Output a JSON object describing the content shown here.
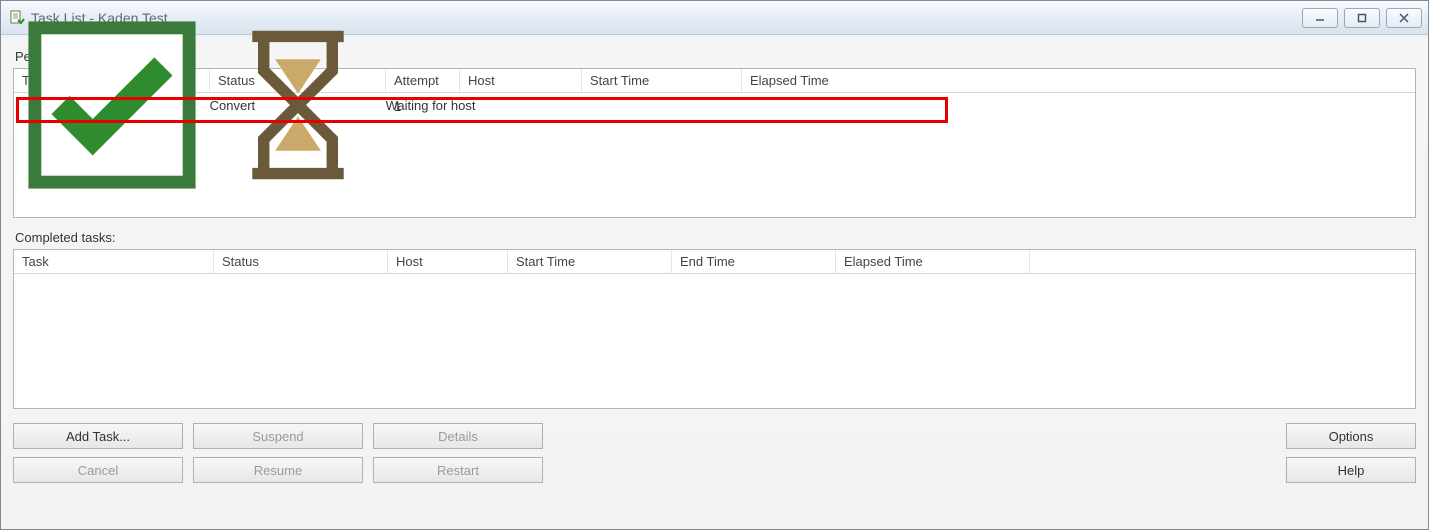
{
  "window": {
    "title": "Task List - Kaden Test"
  },
  "sections": {
    "pending_label": "Pending tasks:",
    "completed_label": "Completed tasks:"
  },
  "pending": {
    "headers": {
      "task": "Task",
      "status": "Status",
      "attempt": "Attempt",
      "host": "Host",
      "start_time": "Start Time",
      "elapsed_time": "Elapsed Time"
    },
    "rows": [
      {
        "task": "Convert",
        "status": "Waiting for host",
        "attempt": "1",
        "host": "",
        "start_time": "",
        "elapsed_time": ""
      }
    ]
  },
  "completed": {
    "headers": {
      "task": "Task",
      "status": "Status",
      "host": "Host",
      "start_time": "Start Time",
      "end_time": "End Time",
      "elapsed_time": "Elapsed Time"
    }
  },
  "buttons": {
    "add_task": "Add Task...",
    "suspend": "Suspend",
    "details": "Details",
    "cancel": "Cancel",
    "resume": "Resume",
    "restart": "Restart",
    "options": "Options",
    "help": "Help"
  }
}
